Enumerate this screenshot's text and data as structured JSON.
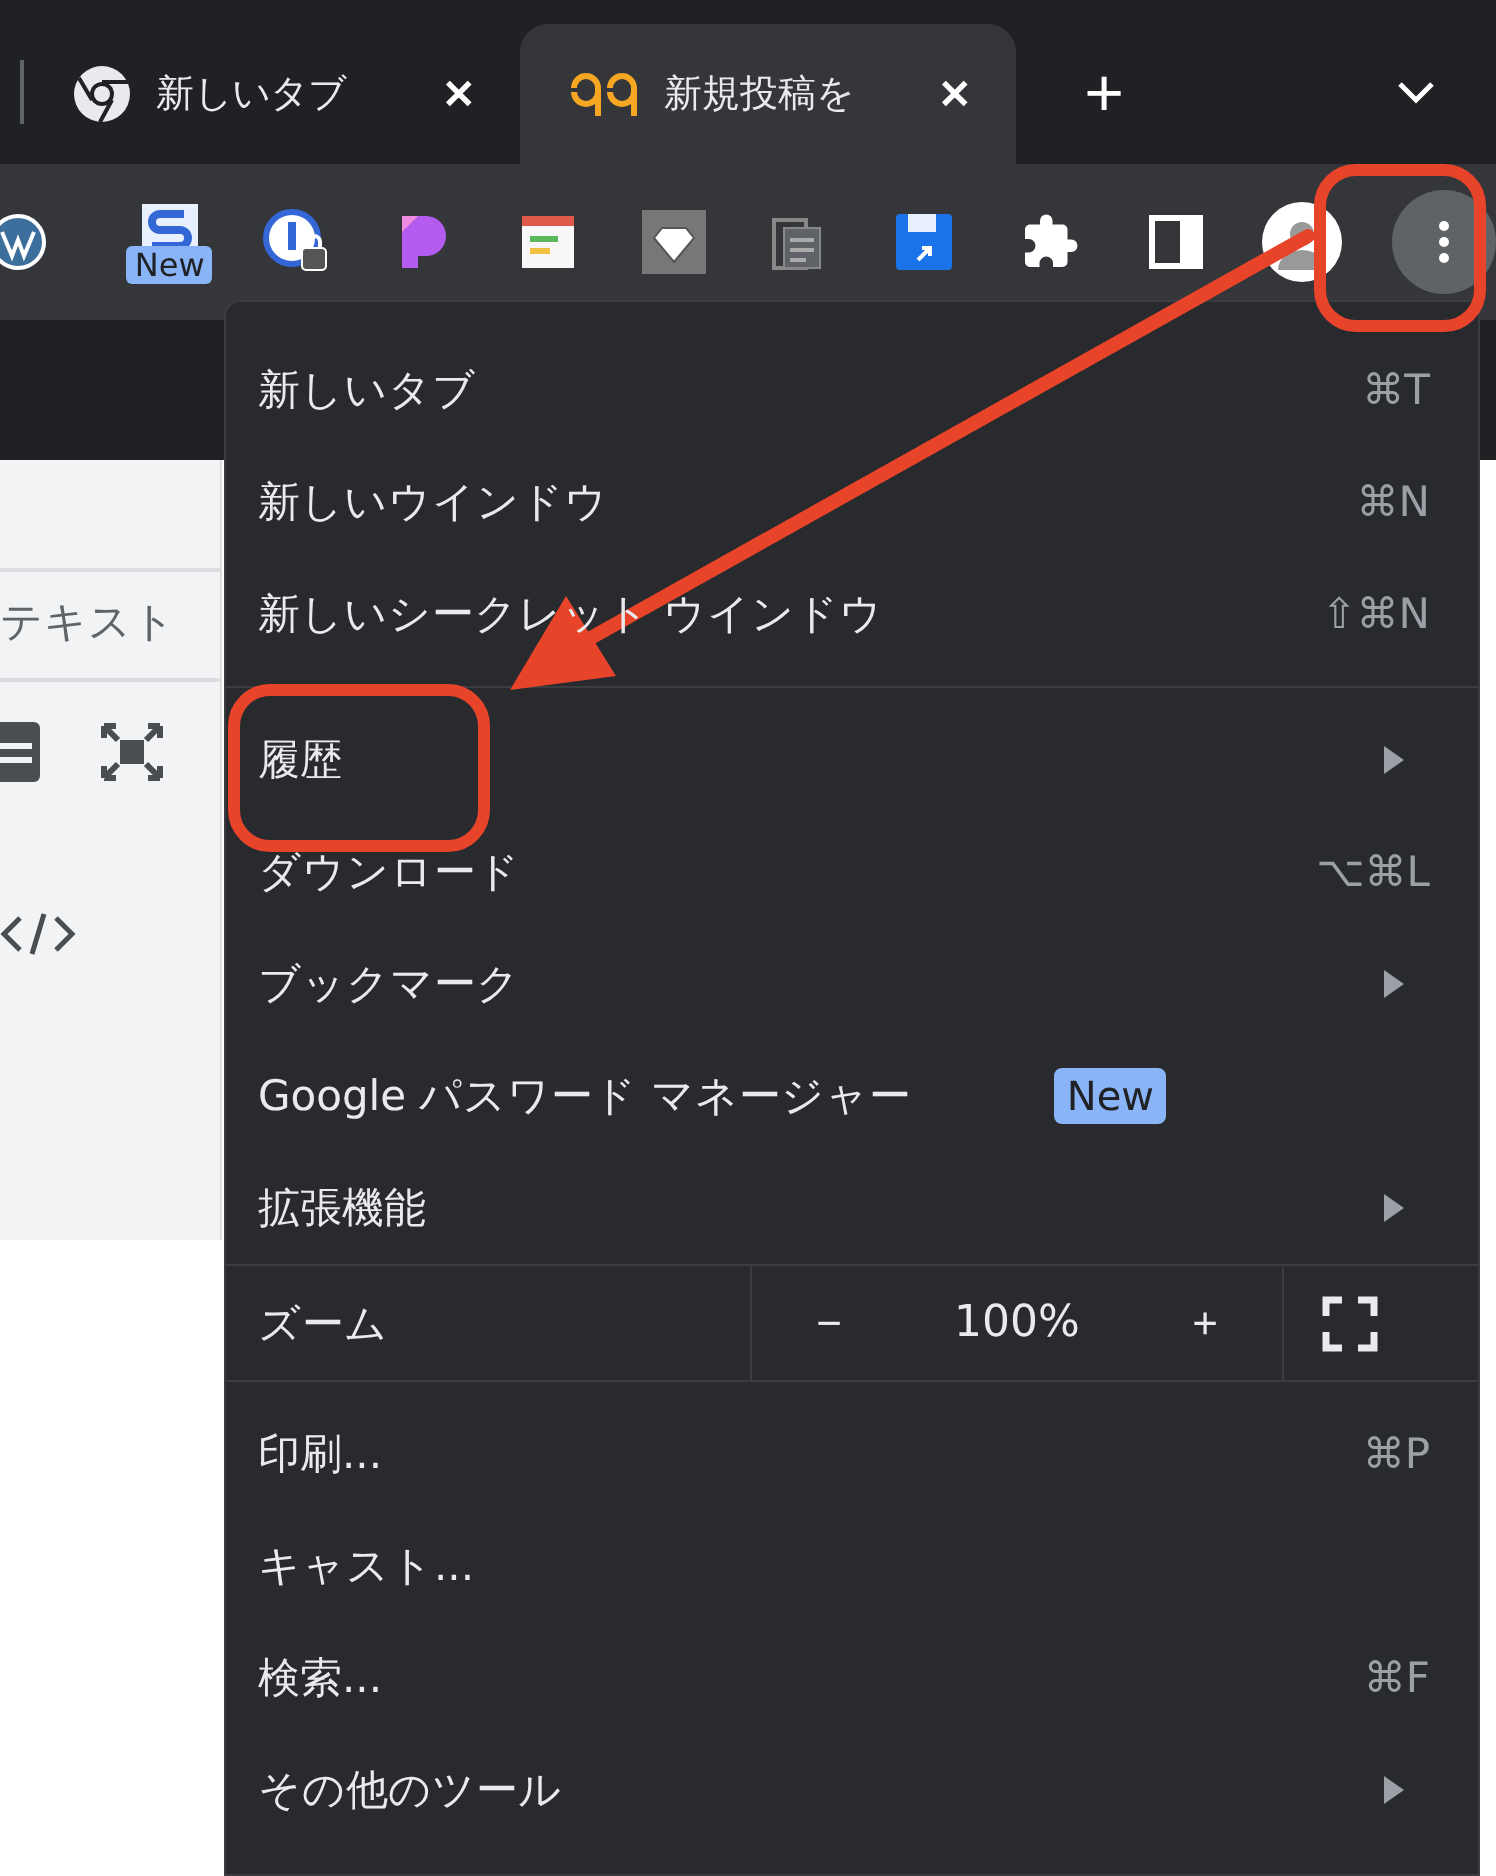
{
  "tabs": [
    {
      "title": "新しいタブ",
      "kind": "chrome",
      "selected": false,
      "close": "✕"
    },
    {
      "title": "新規投稿を",
      "kind": "note",
      "selected": true,
      "close": "✕"
    }
  ],
  "new_tab": "+",
  "toolbar": {
    "extensions": [
      {
        "kind": "wordpress"
      },
      {
        "kind": "s-app",
        "badge": "New"
      },
      {
        "kind": "password"
      },
      {
        "kind": "p-app"
      },
      {
        "kind": "form"
      },
      {
        "kind": "diamond"
      },
      {
        "kind": "docs"
      },
      {
        "kind": "save"
      },
      {
        "kind": "puzzle"
      },
      {
        "kind": "sidebar"
      },
      {
        "kind": "avatar"
      }
    ]
  },
  "page": {
    "label": "テキスト"
  },
  "menu": {
    "groups": [
      {
        "kind": "items",
        "items": [
          {
            "label": "新しいタブ",
            "shortcut": "⌘T",
            "submenu": false
          },
          {
            "label": "新しいウインドウ",
            "shortcut": "⌘N",
            "submenu": false
          },
          {
            "label": "新しいシークレット ウインドウ",
            "shortcut": "⇧⌘N",
            "submenu": false
          }
        ]
      },
      {
        "kind": "items",
        "items": [
          {
            "label": "履歴",
            "submenu": true
          },
          {
            "label": "ダウンロード",
            "shortcut": "⌥⌘L",
            "submenu": false
          },
          {
            "label": "ブックマーク",
            "submenu": true
          },
          {
            "label": "Google パスワード マネージャー",
            "badge": "New",
            "submenu": false
          },
          {
            "label": "拡張機能",
            "submenu": true
          }
        ]
      },
      {
        "kind": "zoom",
        "label": "ズーム",
        "minus": "−",
        "value": "100%",
        "plus": "+"
      },
      {
        "kind": "items",
        "items": [
          {
            "label": "印刷...",
            "shortcut": "⌘P",
            "submenu": false
          },
          {
            "label": "キャスト...",
            "submenu": false
          },
          {
            "label": "検索...",
            "shortcut": "⌘F",
            "submenu": false
          },
          {
            "label": "その他のツール",
            "submenu": true
          }
        ]
      }
    ]
  }
}
